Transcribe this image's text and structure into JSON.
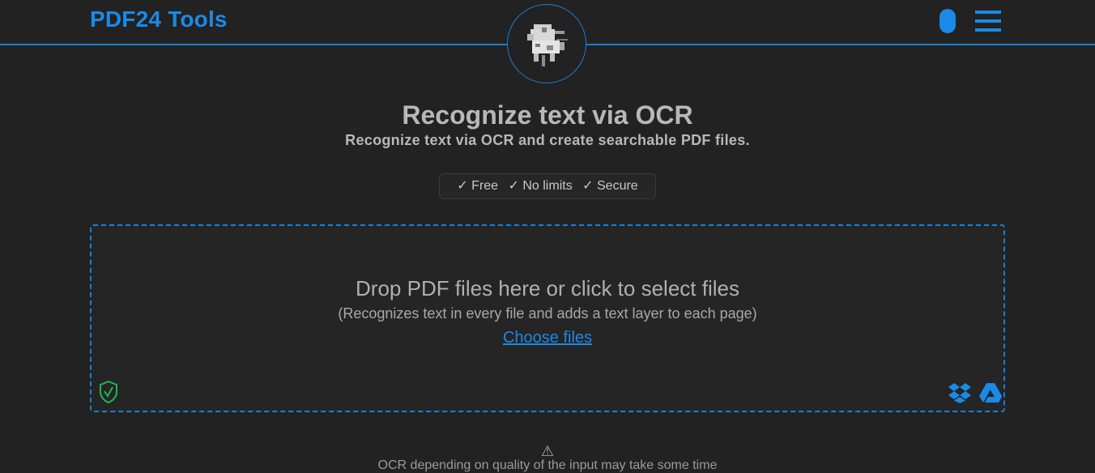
{
  "header": {
    "brand": "PDF24 Tools"
  },
  "hero": {
    "title": "Recognize text via OCR",
    "subtitle": "Recognize text via OCR and create searchable PDF files."
  },
  "features": {
    "items": [
      "✓ Free",
      "✓ No limits",
      "✓ Secure"
    ]
  },
  "dropzone": {
    "title": "Drop PDF files here or click to select files",
    "description": "(Recognizes text in every file and adds a text layer to each page)",
    "choose_label": "Choose files"
  },
  "notice": {
    "warning_glyph": "⚠",
    "text": "OCR depending on quality of the input may take some time"
  },
  "colors": {
    "accent": "#1a8ae6",
    "background": "#222222",
    "secure": "#1db954"
  }
}
